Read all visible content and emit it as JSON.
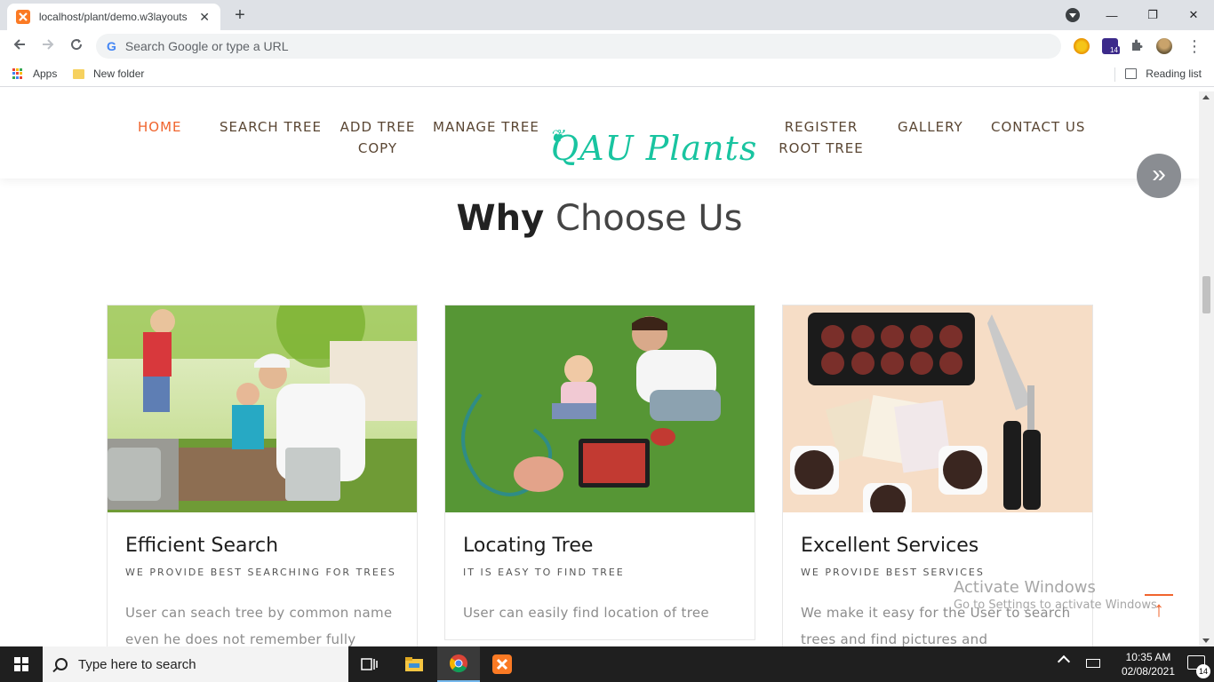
{
  "browser": {
    "tab_title": "localhost/plant/demo.w3layouts",
    "tab_close": "✕",
    "new_tab": "+",
    "window_controls": {
      "minimize": "—",
      "maximize": "❐",
      "close": "✕"
    },
    "omnibox_placeholder": "Search Google or type a URL",
    "omnibox_g": "G",
    "bookmarks": [
      {
        "label": "Apps"
      },
      {
        "label": "New folder"
      }
    ],
    "reading_list": "Reading list",
    "extension_badge": "14"
  },
  "site": {
    "nav": [
      {
        "label": "HOME",
        "active": true
      },
      {
        "label": "SEARCH TREE",
        "active": false
      },
      {
        "label": "ADD TREE COPY",
        "active": false
      },
      {
        "label": "MANAGE TREE",
        "active": false
      },
      {
        "label": "REGISTER ROOT TREE",
        "active": false
      },
      {
        "label": "GALLERY",
        "active": false
      },
      {
        "label": "CONTACT US",
        "active": false
      }
    ],
    "logo": "QAU Plants",
    "float_button": "»",
    "section_title_bold": "Why",
    "section_title_light": "Choose Us",
    "cards": [
      {
        "title": "Efficient Search",
        "subtitle": "WE PROVIDE BEST SEARCHING FOR TREES",
        "text": "User can seach tree by common name even he does not remember fully"
      },
      {
        "title": "Locating Tree",
        "subtitle": "IT IS EASY TO FIND TREE",
        "text": "User can easily find location of tree"
      },
      {
        "title": "Excellent Services",
        "subtitle": "WE PROVIDE BEST SERVICES",
        "text": "We make it easy for the User to search trees and find pictures and"
      }
    ],
    "back_to_top": "↑"
  },
  "watermark": {
    "line1": "Activate Windows",
    "line2": "Go to Settings to activate Windows."
  },
  "taskbar": {
    "search_placeholder": "Type here to search",
    "time": "10:35 AM",
    "date": "02/08/2021",
    "notification_count": "14"
  },
  "colors": {
    "accent": "#f0642d",
    "logo": "#19c4a0",
    "nav_text": "#5a4633"
  }
}
